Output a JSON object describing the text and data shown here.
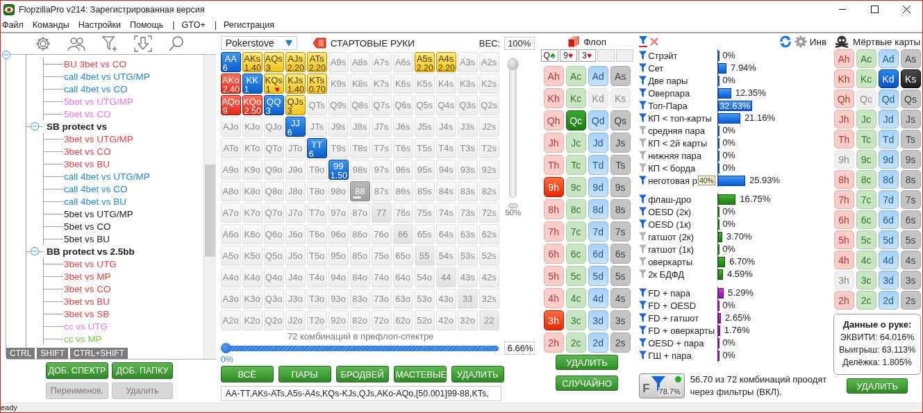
{
  "window": {
    "title": "FlopzillaPro v214: Зарегистрированная версия"
  },
  "menu": [
    {
      "kind": "item",
      "label": "Файл"
    },
    {
      "kind": "item",
      "label": "Команды"
    },
    {
      "kind": "item",
      "label": "Настройки"
    },
    {
      "kind": "item",
      "label": "Помощь"
    },
    {
      "kind": "separator",
      "label": "|"
    },
    {
      "kind": "item",
      "label": "GTO+"
    },
    {
      "kind": "separator",
      "label": "|"
    },
    {
      "kind": "item",
      "label": "Регистрация"
    }
  ],
  "tree": {
    "expanded": true,
    "children": [
      {
        "children": [
          {
            "label": "BU 3bet vs CO",
            "color": "#e8413c"
          },
          {
            "label": "call 4bet vs UTG/MP",
            "color": "#1e8ad6"
          },
          {
            "label": "call 4bet vs CO",
            "color": "#1e8ad6"
          },
          {
            "label": "5bet vs UTG/MP",
            "color": "#f070f0"
          },
          {
            "label": "5bet vs CO",
            "color": "#f070f0"
          }
        ]
      },
      {
        "label": "SB protect vs",
        "expanded": true,
        "children": [
          {
            "label": "3bet vs UTG/MP",
            "color": "#e8413c"
          },
          {
            "label": "3bet vs CO",
            "color": "#e8413c"
          },
          {
            "label": "3bet vs BU",
            "color": "#e8413c"
          },
          {
            "label": "call 4bet vs UTG/MP",
            "color": "#1e8ad6"
          },
          {
            "label": "call 4bet vs CO",
            "color": "#1e8ad6"
          },
          {
            "label": "call 4bet vs BU",
            "color": "#1e8ad6"
          },
          {
            "label": "5bet vs UTG/MP",
            "color": "#222222"
          },
          {
            "label": "5bet vs CO",
            "color": "#222222"
          },
          {
            "label": "5bet vs BU",
            "color": "#222222"
          }
        ]
      },
      {
        "label": "BB protect vs 2.5bb",
        "expanded": true,
        "children": [
          {
            "label": "3bet vs UTG",
            "color": "#e8413c"
          },
          {
            "label": "3bet vs MP",
            "color": "#e8413c"
          },
          {
            "label": "3bet vs CO",
            "color": "#e8413c"
          },
          {
            "label": "3bet vs BU",
            "color": "#e8413c"
          },
          {
            "label": "3bet vs SB",
            "color": "#e8413c"
          },
          {
            "label": "cc vs UTG",
            "color": "#f070f0"
          },
          {
            "label": "cc vs MP",
            "color": "#7ac943"
          }
        ]
      }
    ]
  },
  "modifier_keys": [
    "CTRL",
    "SHIFT",
    "CTRL+SHIFT"
  ],
  "tree_buttons": [
    {
      "label": "ДОБ. СПЕКТР",
      "disabled": false
    },
    {
      "label": "ДОБ. ПАПКУ",
      "disabled": false
    },
    {
      "label": "Переименов.",
      "disabled": true
    },
    {
      "label": "Удалить",
      "disabled": true
    }
  ],
  "range": {
    "source": "Pokerstove",
    "title": "СТАРТОВЫЕ РУКИ",
    "weight_label": "ВЕС:",
    "weight": "100%",
    "grid": [
      [
        {
          "label": "AA",
          "selected": true,
          "weight": "6"
        },
        {
          "label": "AKs",
          "selected": true,
          "weight": "1.40"
        },
        {
          "label": "AQs",
          "selected": true,
          "weight": "3"
        },
        {
          "label": "AJs",
          "selected": true,
          "weight": "2.20"
        },
        {
          "label": "ATs",
          "selected": true,
          "weight": "2.20"
        },
        {
          "label": "A9s",
          "selected": false
        },
        {
          "label": "A8s",
          "selected": false
        },
        {
          "label": "A7s",
          "selected": false
        },
        {
          "label": "A6s",
          "selected": false
        },
        {
          "label": "A5s",
          "selected": true,
          "weight": "2.20"
        },
        {
          "label": "A4s",
          "selected": true,
          "weight": "2.20"
        },
        {
          "label": "A3s",
          "selected": false
        },
        {
          "label": "A2s",
          "selected": false
        }
      ],
      [
        {
          "label": "AKo",
          "selected": true,
          "weight": "2.40"
        },
        {
          "label": "KK",
          "selected": true,
          "weight": "1"
        },
        {
          "label": "KQs",
          "selected": true,
          "weight": "1",
          "mark": "♥"
        },
        {
          "label": "KJs",
          "selected": true,
          "weight": "1.40"
        },
        {
          "label": "KTs",
          "selected": true,
          "weight": "0.70"
        },
        {
          "label": "K9s",
          "selected": false
        },
        {
          "label": "K8s",
          "selected": false
        },
        {
          "label": "K7s",
          "selected": false
        },
        {
          "label": "K6s",
          "selected": false
        },
        {
          "label": "K5s",
          "selected": false
        },
        {
          "label": "K4s",
          "selected": false
        },
        {
          "label": "K3s",
          "selected": false
        },
        {
          "label": "K2s",
          "selected": false
        }
      ],
      [
        {
          "label": "AQo",
          "selected": true,
          "weight": "9"
        },
        {
          "label": "KQo",
          "selected": true,
          "weight": "2.50"
        },
        {
          "label": "QQ",
          "selected": true,
          "weight": "3"
        },
        {
          "label": "QJs",
          "selected": true,
          "weight": "3"
        },
        {
          "label": "QTs",
          "selected": false
        },
        {
          "label": "Q9s",
          "selected": false
        },
        {
          "label": "Q8s",
          "selected": false
        },
        {
          "label": "Q7s",
          "selected": false
        },
        {
          "label": "Q6s",
          "selected": false
        },
        {
          "label": "Q5s",
          "selected": false
        },
        {
          "label": "Q4s",
          "selected": false
        },
        {
          "label": "Q3s",
          "selected": false
        },
        {
          "label": "Q2s",
          "selected": false
        }
      ],
      [
        {
          "label": "AJo",
          "selected": false
        },
        {
          "label": "KJo",
          "selected": false
        },
        {
          "label": "QJo",
          "selected": false
        },
        {
          "label": "JJ",
          "selected": true,
          "weight": "6"
        },
        {
          "label": "JTs",
          "selected": false
        },
        {
          "label": "J9s",
          "selected": false
        },
        {
          "label": "J8s",
          "selected": false
        },
        {
          "label": "J7s",
          "selected": false
        },
        {
          "label": "J6s",
          "selected": false
        },
        {
          "label": "J5s",
          "selected": false
        },
        {
          "label": "J4s",
          "selected": false
        },
        {
          "label": "J3s",
          "selected": false
        },
        {
          "label": "J2s",
          "selected": false
        }
      ],
      [
        {
          "label": "ATo",
          "selected": false
        },
        {
          "label": "KTo",
          "selected": false
        },
        {
          "label": "QTo",
          "selected": false
        },
        {
          "label": "JTo",
          "selected": false
        },
        {
          "label": "TT",
          "selected": true,
          "weight": "6"
        },
        {
          "label": "T9s",
          "selected": false
        },
        {
          "label": "T8s",
          "selected": false
        },
        {
          "label": "T7s",
          "selected": false
        },
        {
          "label": "T6s",
          "selected": false
        },
        {
          "label": "T5s",
          "selected": false
        },
        {
          "label": "T4s",
          "selected": false
        },
        {
          "label": "T3s",
          "selected": false
        },
        {
          "label": "T2s",
          "selected": false
        }
      ],
      [
        {
          "label": "A9o",
          "selected": false
        },
        {
          "label": "K9o",
          "selected": false
        },
        {
          "label": "Q9o",
          "selected": false
        },
        {
          "label": "J9o",
          "selected": false
        },
        {
          "label": "T9o",
          "selected": false
        },
        {
          "label": "99",
          "selected": true,
          "weight": "1.50"
        },
        {
          "label": "98s",
          "selected": false
        },
        {
          "label": "97s",
          "selected": false
        },
        {
          "label": "96s",
          "selected": false
        },
        {
          "label": "95s",
          "selected": false
        },
        {
          "label": "94s",
          "selected": false
        },
        {
          "label": "93s",
          "selected": false
        },
        {
          "label": "92s",
          "selected": false
        }
      ],
      [
        {
          "label": "A8o",
          "selected": false
        },
        {
          "label": "K8o",
          "selected": false
        },
        {
          "label": "Q8o",
          "selected": false
        },
        {
          "label": "J8o",
          "selected": false
        },
        {
          "label": "T8o",
          "selected": false
        },
        {
          "label": "98o",
          "selected": false
        },
        {
          "label": "88",
          "selected": false,
          "focused": true
        },
        {
          "label": "87s",
          "selected": false
        },
        {
          "label": "86s",
          "selected": false
        },
        {
          "label": "85s",
          "selected": false
        },
        {
          "label": "84s",
          "selected": false
        },
        {
          "label": "83s",
          "selected": false
        },
        {
          "label": "82s",
          "selected": false
        }
      ],
      [
        {
          "label": "A7o",
          "selected": false
        },
        {
          "label": "K7o",
          "selected": false
        },
        {
          "label": "Q7o",
          "selected": false
        },
        {
          "label": "J7o",
          "selected": false
        },
        {
          "label": "T7o",
          "selected": false
        },
        {
          "label": "97o",
          "selected": false
        },
        {
          "label": "87o",
          "selected": false
        },
        {
          "label": "77",
          "selected": false
        },
        {
          "label": "76s",
          "selected": false
        },
        {
          "label": "75s",
          "selected": false
        },
        {
          "label": "74s",
          "selected": false
        },
        {
          "label": "73s",
          "selected": false
        },
        {
          "label": "72s",
          "selected": false
        }
      ],
      [
        {
          "label": "A6o",
          "selected": false
        },
        {
          "label": "K6o",
          "selected": false
        },
        {
          "label": "Q6o",
          "selected": false
        },
        {
          "label": "J6o",
          "selected": false
        },
        {
          "label": "T6o",
          "selected": false
        },
        {
          "label": "96o",
          "selected": false
        },
        {
          "label": "86o",
          "selected": false
        },
        {
          "label": "76o",
          "selected": false
        },
        {
          "label": "66",
          "selected": false
        },
        {
          "label": "65s",
          "selected": false
        },
        {
          "label": "64s",
          "selected": false
        },
        {
          "label": "63s",
          "selected": false
        },
        {
          "label": "62s",
          "selected": false
        }
      ],
      [
        {
          "label": "A5o",
          "selected": false
        },
        {
          "label": "K5o",
          "selected": false
        },
        {
          "label": "Q5o",
          "selected": false
        },
        {
          "label": "J5o",
          "selected": false
        },
        {
          "label": "T5o",
          "selected": false
        },
        {
          "label": "95o",
          "selected": false
        },
        {
          "label": "85o",
          "selected": false
        },
        {
          "label": "75o",
          "selected": false
        },
        {
          "label": "65o",
          "selected": false
        },
        {
          "label": "55",
          "selected": false
        },
        {
          "label": "54s",
          "selected": false
        },
        {
          "label": "53s",
          "selected": false
        },
        {
          "label": "52s",
          "selected": false
        }
      ],
      [
        {
          "label": "A4o",
          "selected": false
        },
        {
          "label": "K4o",
          "selected": false
        },
        {
          "label": "Q4o",
          "selected": false
        },
        {
          "label": "J4o",
          "selected": false
        },
        {
          "label": "T4o",
          "selected": false
        },
        {
          "label": "94o",
          "selected": false
        },
        {
          "label": "84o",
          "selected": false
        },
        {
          "label": "74o",
          "selected": false
        },
        {
          "label": "64o",
          "selected": false
        },
        {
          "label": "54o",
          "selected": false
        },
        {
          "label": "44",
          "selected": false
        },
        {
          "label": "43s",
          "selected": false
        },
        {
          "label": "42s",
          "selected": false
        }
      ],
      [
        {
          "label": "A3o",
          "selected": false
        },
        {
          "label": "K3o",
          "selected": false
        },
        {
          "label": "Q3o",
          "selected": false
        },
        {
          "label": "J3o",
          "selected": false
        },
        {
          "label": "T3o",
          "selected": false
        },
        {
          "label": "93o",
          "selected": false
        },
        {
          "label": "83o",
          "selected": false
        },
        {
          "label": "73o",
          "selected": false
        },
        {
          "label": "63o",
          "selected": false
        },
        {
          "label": "53o",
          "selected": false
        },
        {
          "label": "43o",
          "selected": false
        },
        {
          "label": "33",
          "selected": false
        },
        {
          "label": "32s",
          "selected": false
        }
      ],
      [
        {
          "label": "A2o",
          "selected": false
        },
        {
          "label": "K2o",
          "selected": false
        },
        {
          "label": "Q2o",
          "selected": false
        },
        {
          "label": "J2o",
          "selected": false
        },
        {
          "label": "T2o",
          "selected": false
        },
        {
          "label": "92o",
          "selected": false
        },
        {
          "label": "82o",
          "selected": false
        },
        {
          "label": "72o",
          "selected": false
        },
        {
          "label": "62o",
          "selected": false
        },
        {
          "label": "52o",
          "selected": false
        },
        {
          "label": "42o",
          "selected": false
        },
        {
          "label": "32o",
          "selected": false
        },
        {
          "label": "22",
          "selected": false
        }
      ]
    ],
    "weight_slider": {
      "level": 1,
      "reading": "50%"
    },
    "caption": "72 комбинаций в префлоп-спектре",
    "range_slider": {
      "level": 0,
      "min_label": "0%",
      "value": "6.66%"
    },
    "buttons": [
      "ВСЁ",
      "ПАРЫ",
      "БРОДВЕЙ",
      "МАСТЕВЫЕ",
      "УДАЛИТЬ"
    ],
    "range_text": "AA-TT,AKs-ATs,A5s-A4s,KQs-KJs,QJs,AKo-AQo,[50.001]99-88,KTs,"
  },
  "flop": {
    "title": "Флоп",
    "board": [
      {
        "kind": "card",
        "rank": "Q",
        "suit": "♣",
        "color": "#1a9a1a"
      },
      {
        "kind": "card",
        "rank": "9",
        "suit": "♥",
        "color": "#e01010"
      },
      {
        "kind": "card",
        "rank": "3",
        "suit": "♥",
        "color": "#e01010"
      },
      {
        "kind": "empty"
      },
      {
        "kind": "empty"
      }
    ],
    "cards": [
      [
        {
          "label": "Ah",
          "selected": false,
          "disabled": false
        },
        {
          "label": "Ac",
          "selected": false,
          "disabled": false
        },
        {
          "label": "Ad",
          "selected": false,
          "disabled": false
        },
        {
          "label": "As",
          "selected": false,
          "disabled": false
        }
      ],
      [
        {
          "label": "Kh",
          "selected": false,
          "disabled": false
        },
        {
          "label": "Kc",
          "selected": false,
          "disabled": false
        },
        {
          "label": "Kd",
          "selected": false,
          "disabled": true
        },
        {
          "label": "Ks",
          "selected": false,
          "disabled": true
        }
      ],
      [
        {
          "label": "Qh",
          "selected": false,
          "disabled": false
        },
        {
          "label": "Qc",
          "selected": true,
          "disabled": false
        },
        {
          "label": "Qd",
          "selected": false,
          "disabled": false
        },
        {
          "label": "Qs",
          "selected": false,
          "disabled": false
        }
      ],
      [
        {
          "label": "Jh",
          "selected": false,
          "disabled": false
        },
        {
          "label": "Jc",
          "selected": false,
          "disabled": false
        },
        {
          "label": "Jd",
          "selected": false,
          "disabled": false
        },
        {
          "label": "Js",
          "selected": false,
          "disabled": false
        }
      ],
      [
        {
          "label": "Th",
          "selected": false,
          "disabled": false
        },
        {
          "label": "Tc",
          "selected": false,
          "disabled": false
        },
        {
          "label": "Td",
          "selected": false,
          "disabled": false
        },
        {
          "label": "Ts",
          "selected": false,
          "disabled": false
        }
      ],
      [
        {
          "label": "9h",
          "selected": true,
          "disabled": false
        },
        {
          "label": "9c",
          "selected": false,
          "disabled": false
        },
        {
          "label": "9d",
          "selected": false,
          "disabled": false
        },
        {
          "label": "9s",
          "selected": false,
          "disabled": false
        }
      ],
      [
        {
          "label": "8h",
          "selected": false,
          "disabled": false
        },
        {
          "label": "8c",
          "selected": false,
          "disabled": false
        },
        {
          "label": "8d",
          "selected": false,
          "disabled": false
        },
        {
          "label": "8s",
          "selected": false,
          "disabled": false
        }
      ],
      [
        {
          "label": "7h",
          "selected": false,
          "disabled": false
        },
        {
          "label": "7c",
          "selected": false,
          "disabled": false
        },
        {
          "label": "7d",
          "selected": false,
          "disabled": false
        },
        {
          "label": "7s",
          "selected": false,
          "disabled": false
        }
      ],
      [
        {
          "label": "6h",
          "selected": false,
          "disabled": false
        },
        {
          "label": "6c",
          "selected": false,
          "disabled": false
        },
        {
          "label": "6d",
          "selected": false,
          "disabled": false
        },
        {
          "label": "6s",
          "selected": false,
          "disabled": false
        }
      ],
      [
        {
          "label": "5h",
          "selected": false,
          "disabled": false
        },
        {
          "label": "5c",
          "selected": false,
          "disabled": false
        },
        {
          "label": "5d",
          "selected": false,
          "disabled": false
        },
        {
          "label": "5s",
          "selected": false,
          "disabled": false
        }
      ],
      [
        {
          "label": "4h",
          "selected": false,
          "disabled": false
        },
        {
          "label": "4c",
          "selected": false,
          "disabled": false
        },
        {
          "label": "4d",
          "selected": false,
          "disabled": false
        },
        {
          "label": "4s",
          "selected": false,
          "disabled": false
        }
      ],
      [
        {
          "label": "3h",
          "selected": true,
          "disabled": false
        },
        {
          "label": "3c",
          "selected": false,
          "disabled": false
        },
        {
          "label": "3d",
          "selected": false,
          "disabled": false
        },
        {
          "label": "3s",
          "selected": false,
          "disabled": false
        }
      ],
      [
        {
          "label": "2h",
          "selected": false,
          "disabled": false
        },
        {
          "label": "2c",
          "selected": false,
          "disabled": false
        },
        {
          "label": "2d",
          "selected": false,
          "disabled": false
        },
        {
          "label": "2s",
          "selected": false,
          "disabled": false
        }
      ]
    ],
    "buttons": [
      "УДАЛИТЬ",
      "СЛУЧАЙНО"
    ]
  },
  "filters": {
    "invert_label": "Инв",
    "groups": [
      {
        "rows": [
          {
            "label": "Стрэйт",
            "active": true,
            "value": "0%",
            "level": 0
          },
          {
            "label": "Сет",
            "active": true,
            "value": "7.94%",
            "level": 0.0794
          },
          {
            "label": "Две пары",
            "active": true,
            "value": "0%",
            "level": 0
          },
          {
            "label": "Оверпара",
            "active": true,
            "value": "12.35%",
            "level": 0.1235
          },
          {
            "label": "Топ-Пара",
            "active": true,
            "value": "32.63%",
            "level": 0.3263
          },
          {
            "label": "КП < топ-карты",
            "active": true,
            "value": "21.16%",
            "level": 0.2116
          },
          {
            "label": "средняя пара",
            "active": false,
            "value": "0%",
            "level": 0
          },
          {
            "label": "КП < 2й карты",
            "active": false,
            "value": "0%",
            "level": 0
          },
          {
            "label": "нижняя пара",
            "active": false,
            "value": "0%",
            "level": 0
          },
          {
            "label": "КП < борда",
            "active": false,
            "value": "0%",
            "level": 0
          },
          {
            "label": "неготовая р",
            "active": true,
            "value": "25.93%",
            "level": 0.2593,
            "tooltip": "40%"
          }
        ]
      },
      {
        "rows": [
          {
            "label": "флаш-дро",
            "active": true,
            "value": "16.75%",
            "level": 0.1675
          },
          {
            "label": "OESD (2к)",
            "active": true,
            "value": "0%",
            "level": 0
          },
          {
            "label": "OESD (1к)",
            "active": true,
            "value": "0%",
            "level": 0
          },
          {
            "label": "гатшот (2к)",
            "active": false,
            "value": "3.70%",
            "level": 0.037
          },
          {
            "label": "гатшот (1к)",
            "active": false,
            "value": "0%",
            "level": 0
          },
          {
            "label": "оверкарты",
            "active": false,
            "value": "6.70%",
            "level": 0.067
          },
          {
            "label": "2к БДФД",
            "active": false,
            "value": "4.59%",
            "level": 0.0459
          }
        ]
      },
      {
        "rows": [
          {
            "label": "FD + пара",
            "active": true,
            "value": "5.29%",
            "level": 0.0529
          },
          {
            "label": "FD + OESD",
            "active": true,
            "value": "0%",
            "level": 0
          },
          {
            "label": "FD + гатшот",
            "active": true,
            "value": "2.65%",
            "level": 0.0265
          },
          {
            "label": "FD + оверкарты",
            "active": true,
            "value": "1.76%",
            "level": 0.0176
          },
          {
            "label": "OESD + пара",
            "active": true,
            "value": "0%",
            "level": 0
          },
          {
            "label": "ГШ + пара",
            "active": true,
            "value": "0%",
            "level": 0
          }
        ]
      }
    ],
    "summary_button": {
      "letter": "F",
      "value": "78.7%",
      "on": true
    },
    "summary": "56.70 из 72 комбинаций проодят через фильтры (ВКЛ)."
  },
  "dead": {
    "title": "Мёртвые карты",
    "cards": [
      [
        {
          "label": "Ah",
          "selected": false,
          "disabled": false
        },
        {
          "label": "Ac",
          "selected": false,
          "disabled": false
        },
        {
          "label": "Ad",
          "selected": false,
          "disabled": false
        },
        {
          "label": "As",
          "selected": false,
          "disabled": false
        }
      ],
      [
        {
          "label": "Kh",
          "selected": false,
          "disabled": false
        },
        {
          "label": "Kc",
          "selected": false,
          "disabled": false
        },
        {
          "label": "Kd",
          "selected": true,
          "disabled": false
        },
        {
          "label": "Ks",
          "selected": true,
          "disabled": false
        }
      ],
      [
        {
          "label": "Qh",
          "selected": false,
          "disabled": false
        },
        {
          "label": "Qc",
          "selected": false,
          "disabled": true
        },
        {
          "label": "Qd",
          "selected": false,
          "disabled": false
        },
        {
          "label": "Qs",
          "selected": false,
          "disabled": false
        }
      ],
      [
        {
          "label": "Jh",
          "selected": false,
          "disabled": false
        },
        {
          "label": "Jc",
          "selected": false,
          "disabled": false
        },
        {
          "label": "Jd",
          "selected": false,
          "disabled": false
        },
        {
          "label": "Js",
          "selected": false,
          "disabled": false
        }
      ],
      [
        {
          "label": "Th",
          "selected": false,
          "disabled": false
        },
        {
          "label": "Tc",
          "selected": false,
          "disabled": false
        },
        {
          "label": "Td",
          "selected": false,
          "disabled": false
        },
        {
          "label": "Ts",
          "selected": false,
          "disabled": false
        }
      ],
      [
        {
          "label": "9h",
          "selected": false,
          "disabled": true
        },
        {
          "label": "9c",
          "selected": false,
          "disabled": false
        },
        {
          "label": "9d",
          "selected": false,
          "disabled": false
        },
        {
          "label": "9s",
          "selected": false,
          "disabled": false
        }
      ],
      [
        {
          "label": "8h",
          "selected": false,
          "disabled": false
        },
        {
          "label": "8c",
          "selected": false,
          "disabled": false
        },
        {
          "label": "8d",
          "selected": false,
          "disabled": false
        },
        {
          "label": "8s",
          "selected": false,
          "disabled": false
        }
      ],
      [
        {
          "label": "7h",
          "selected": false,
          "disabled": false
        },
        {
          "label": "7c",
          "selected": false,
          "disabled": false
        },
        {
          "label": "7d",
          "selected": false,
          "disabled": false
        },
        {
          "label": "7s",
          "selected": false,
          "disabled": false
        }
      ],
      [
        {
          "label": "6h",
          "selected": false,
          "disabled": false
        },
        {
          "label": "6c",
          "selected": false,
          "disabled": false
        },
        {
          "label": "6d",
          "selected": false,
          "disabled": false
        },
        {
          "label": "6s",
          "selected": false,
          "disabled": false
        }
      ],
      [
        {
          "label": "5h",
          "selected": false,
          "disabled": false
        },
        {
          "label": "5c",
          "selected": false,
          "disabled": false
        },
        {
          "label": "5d",
          "selected": false,
          "disabled": false
        },
        {
          "label": "5s",
          "selected": false,
          "disabled": false
        }
      ],
      [
        {
          "label": "4h",
          "selected": false,
          "disabled": false
        },
        {
          "label": "4c",
          "selected": false,
          "disabled": false
        },
        {
          "label": "4d",
          "selected": false,
          "disabled": false
        },
        {
          "label": "4s",
          "selected": false,
          "disabled": false
        }
      ],
      [
        {
          "label": "3h",
          "selected": false,
          "disabled": true
        },
        {
          "label": "3c",
          "selected": false,
          "disabled": false
        },
        {
          "label": "3d",
          "selected": false,
          "disabled": false
        },
        {
          "label": "3s",
          "selected": false,
          "disabled": false
        }
      ],
      [
        {
          "label": "2h",
          "selected": false,
          "disabled": false
        },
        {
          "label": "2c",
          "selected": false,
          "disabled": false
        },
        {
          "label": "2d",
          "selected": false,
          "disabled": false
        },
        {
          "label": "2s",
          "selected": false,
          "disabled": false
        }
      ]
    ],
    "hand_data": {
      "title": "Данные о руке:",
      "lines": [
        "ЭКВИТИ: 64.016%",
        "Выигрыш: 63.113%",
        "Делёжка: 1.805%"
      ]
    },
    "button": "УДАЛИТЬ"
  },
  "status_bar": "eady"
}
